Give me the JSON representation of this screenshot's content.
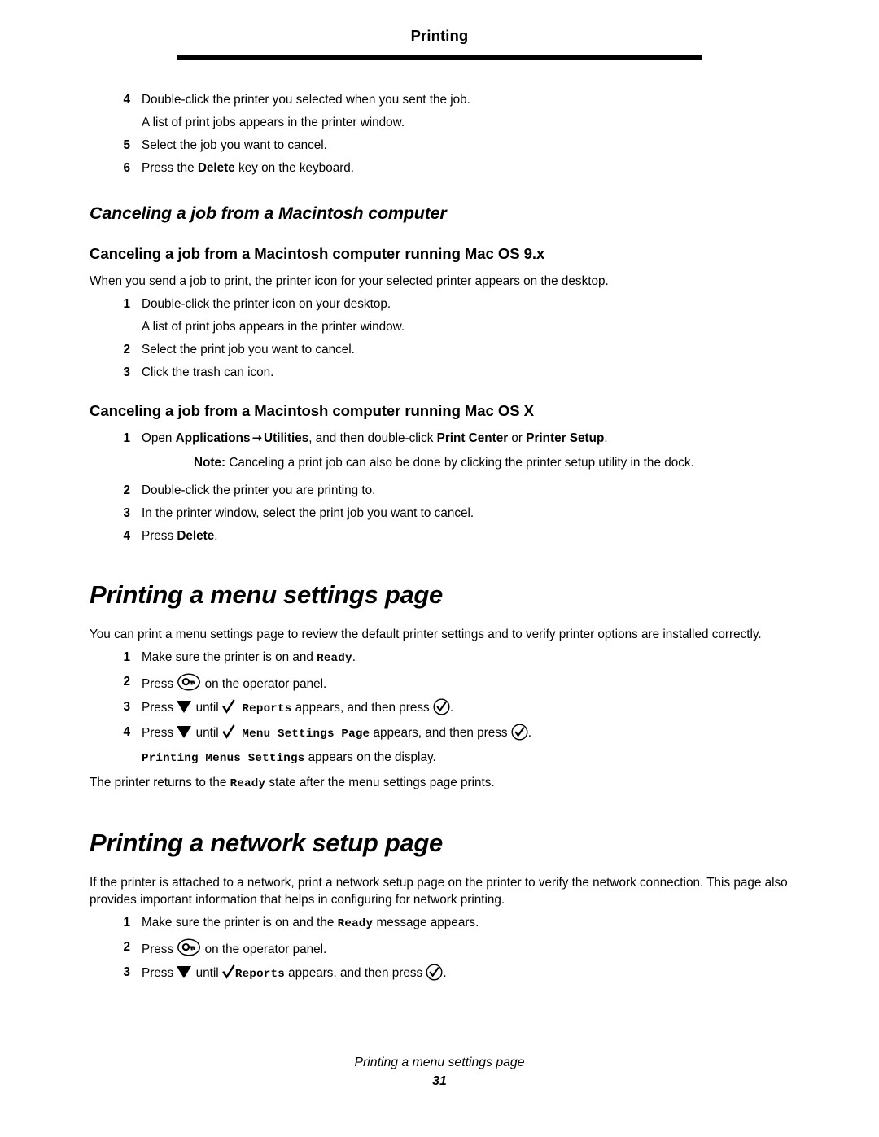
{
  "header": {
    "running_title": "Printing"
  },
  "sections": [
    {
      "id": "mac-cancel-continued",
      "steps": [
        {
          "num": "4",
          "text": "Double-click the printer you selected when you sent the job."
        },
        {
          "num": "",
          "text": "A list of print jobs appears in the printer window."
        },
        {
          "num": "5",
          "text": "Select the job you want to cancel."
        },
        {
          "num": "6",
          "text_before": "Press the ",
          "bold": "Delete",
          "text_after": " key on the keyboard."
        }
      ]
    }
  ],
  "heading_mac": "Canceling a job from a Macintosh computer",
  "heading_mac_os9": "Canceling a job from a Macintosh computer running Mac OS 9.x",
  "intro_os9": "When you send a job to print, the printer icon for your selected printer appears on the desktop.",
  "steps_os9": [
    {
      "num": "1",
      "text": "Double-click the printer icon on your desktop."
    },
    {
      "num": "",
      "text": "A list of print jobs appears in the printer window."
    },
    {
      "num": "2",
      "text": "Select the print job you want to cancel."
    },
    {
      "num": "3",
      "text": "Click the trash can icon."
    }
  ],
  "heading_mac_osx": "Canceling a job from a Macintosh computer running Mac OS X",
  "steps_osx": {
    "step1": {
      "num": "1",
      "open_label": "Open ",
      "applications": "Applications",
      "arrow": "→",
      "utilities": "Utilities",
      "mid": ", and then double-click ",
      "print_center": "Print Center",
      "or": " or ",
      "printer_setup": "Printer Setup",
      "end": "."
    },
    "note": {
      "label": "Note:",
      "text": " Canceling a print job can also be done by clicking the printer setup utility in the dock."
    },
    "rest": [
      {
        "num": "2",
        "text": "Double-click the printer you are printing to."
      },
      {
        "num": "3",
        "text": "In the printer window, select the print job you want to cancel."
      },
      {
        "num": "4",
        "text_before": "Press ",
        "bold": "Delete",
        "text_after": "."
      }
    ]
  },
  "heading_menu_settings": "Printing a menu settings page",
  "intro_menu_settings": "You can print a menu settings page to review the default printer settings and to verify printer options are installed correctly.",
  "steps_menu_settings": {
    "step1": {
      "num": "1",
      "before": "Make sure the printer is on and ",
      "mono": "Ready",
      "after": "."
    },
    "step2": {
      "num": "2",
      "before": "Press ",
      "icon": "key-icon",
      "after": " on the operator panel."
    },
    "step3": {
      "num": "3",
      "press": "Press ",
      "down_icon": "down-arrow-icon",
      "until": " until ",
      "check_icon": "checkmark-icon",
      "mono": "Reports",
      "appears": " appears, and then press ",
      "select_icon": "select-icon",
      "end": "."
    },
    "step4": {
      "num": "4",
      "press": "Press ",
      "down_icon": "down-arrow-icon",
      "until": " until ",
      "check_icon": "checkmark-icon",
      "mono": "Menu Settings Page",
      "appears": " appears, and then press ",
      "select_icon": "select-icon",
      "end": "."
    },
    "display_line": {
      "mono": "Printing Menus Settings",
      "after": " appears on the display."
    },
    "closing": {
      "before": "The printer returns to the ",
      "mono": "Ready",
      "after": " state after the menu settings page prints."
    }
  },
  "heading_network_setup": "Printing a network setup page",
  "intro_network_setup": "If the printer is attached to a network, print a network setup page on the printer to verify the network connection. This page also provides important information that helps in configuring for network printing.",
  "steps_network_setup": {
    "step1": {
      "num": "1",
      "before": "Make sure the printer is on and the ",
      "mono": "Ready",
      "after": " message appears."
    },
    "step2": {
      "num": "2",
      "before": "Press ",
      "icon": "key-icon",
      "after": " on the operator panel."
    },
    "step3": {
      "num": "3",
      "press": "Press ",
      "down_icon": "down-arrow-icon",
      "until": " until ",
      "check_icon": "checkmark-icon",
      "mono": "Reports",
      "appears": " appears, and then press ",
      "select_icon": "select-icon",
      "end": "."
    }
  },
  "footer": {
    "title": "Printing a menu settings page",
    "page_number": "31"
  },
  "colors": {
    "text": "#000000",
    "background": "#ffffff",
    "rule": "#000000"
  }
}
